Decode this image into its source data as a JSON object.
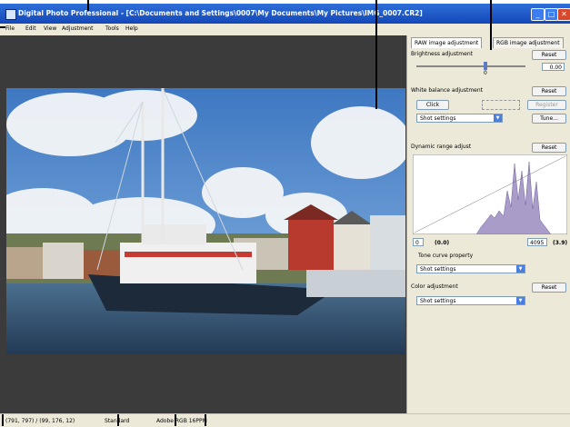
{
  "window": {
    "title": "Digital Photo Professional - [C:\\Documents and Settings\\0007\\My Documents\\My Pictures\\IMG_0007.CR2]",
    "minimize_glyph": "_",
    "maximize_glyph": "□",
    "close_glyph": "✕"
  },
  "menu": {
    "items": [
      "File",
      "Edit",
      "View",
      "Adjustment",
      "Tools",
      "Help"
    ]
  },
  "panel": {
    "tabs": [
      "RAW image adjustment",
      "RGB image adjustment"
    ],
    "brightness": {
      "label": "Brightness adjustment",
      "reset": "Reset",
      "value": "0.00",
      "scale_mid": "0"
    },
    "white_balance": {
      "label": "White balance adjustment",
      "reset": "Reset",
      "click_btn": "Click",
      "register_btn": "Register",
      "select_value": "Shot settings",
      "tune_btn": "Tune..."
    },
    "dynamic_range": {
      "label": "Dynamic range adjust",
      "reset": "Reset",
      "left_value": "0",
      "left_bracket": "(0.0)",
      "right_value": "4095",
      "right_bracket": "(3.9)",
      "tone_curve_label": "Tone curve property",
      "tone_curve_value": "Shot settings"
    },
    "color": {
      "label": "Color adjustment",
      "reset": "Reset",
      "select_value": "Shot settings"
    }
  },
  "status": {
    "coords": "(791, 797) / (99, 176, 12)",
    "mode": "Standard",
    "color_space": "Adobe RGB 16PPM"
  },
  "colors": {
    "titlebar": "#1a52c4",
    "panel_bg": "#ece9d8",
    "viewer_bg": "#3b3b3b",
    "histogram_fill": "#a99cc9"
  },
  "icons": {
    "app": "dpp-app-icon",
    "dropdown": "chevron-down-icon",
    "window_min": "minimize-icon",
    "window_max": "maximize-icon",
    "window_close": "close-icon"
  }
}
